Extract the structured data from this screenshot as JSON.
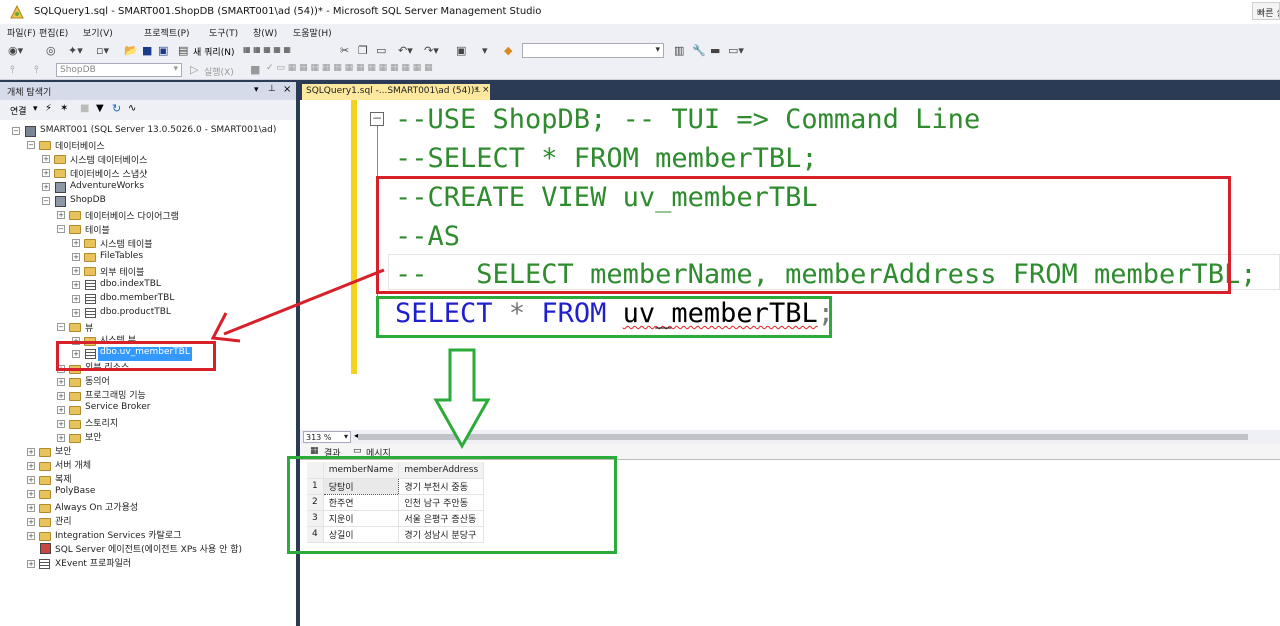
{
  "window": {
    "title": "SQLQuery1.sql - SMART001.ShopDB (SMART001\\ad (54))* - Microsoft SQL Server Management Studio",
    "quick_launch": "빠른 실행"
  },
  "menu": [
    "파일(F)",
    "편집(E)",
    "보기(V)",
    "프로젝트(P)",
    "도구(T)",
    "창(W)",
    "도움말(H)"
  ],
  "toolbar": {
    "new_query": "새 쿼리(N)",
    "database": "ShopDB",
    "execute": "실행(X)"
  },
  "explorer": {
    "title": "개체 탐색기",
    "connect": "연결",
    "server": "SMART001 (SQL Server 13.0.5026.0 - SMART001\\ad)",
    "nodes": {
      "databases": "데이터베이스",
      "system_databases": "시스템 데이터베이스",
      "snapshots": "데이터베이스 스냅샷",
      "adventureworks": "AdventureWorks",
      "shopdb": "ShopDB",
      "diagrams": "데이터베이스 다이어그램",
      "tables": "테이블",
      "system_tables": "시스템 테이블",
      "filetables": "FileTables",
      "external_tables": "외부 테이블",
      "index_tbl": "dbo.indexTBL",
      "member_tbl": "dbo.memberTBL",
      "product_tbl": "dbo.productTBL",
      "views": "뷰",
      "system_views": "시스템 뷰",
      "uv_member": "dbo.uv_memberTBL",
      "external_resources": "외부 리소스",
      "synonyms": "동의어",
      "programmability": "프로그래밍 기능",
      "service_broker": "Service Broker",
      "storage": "스토리지",
      "db_security": "보안",
      "security": "보안",
      "server_objects": "서버 개체",
      "replication": "복제",
      "polybase": "PolyBase",
      "always_on": "Always On 고가용성",
      "management": "관리",
      "integration_services": "Integration Services 카탈로그",
      "sql_agent": "SQL Server 에이전트(에이전트 XPs 사용 안 함)",
      "xevent": "XEvent 프로파일러"
    }
  },
  "editor": {
    "tab_title": "SQLQuery1.sql -...SMART001\\ad (54))*",
    "zoom": "313 %",
    "lines": {
      "l1": "--USE ShopDB; -- TUI => Command Line",
      "l2": "--SELECT * FROM memberTBL;",
      "l3": "--CREATE VIEW uv_memberTBL",
      "l4": "--AS",
      "l5": "--   SELECT memberName, memberAddress FROM memberTBL;",
      "l6_select": "SELECT",
      "l6_star": "*",
      "l6_from": "FROM",
      "l6_obj": "uv_memberTBL",
      "l6_semi": ";"
    }
  },
  "results": {
    "tab_results": "결과",
    "tab_messages": "메시지",
    "columns": [
      "memberName",
      "memberAddress"
    ],
    "rows": [
      {
        "n": "1",
        "name": "당탕이",
        "addr": "경기 부천시 중동"
      },
      {
        "n": "2",
        "name": "한주연",
        "addr": "인천 남구 주안동"
      },
      {
        "n": "3",
        "name": "지운이",
        "addr": "서울 은평구 증산동"
      },
      {
        "n": "4",
        "name": "상길이",
        "addr": "경기 성남시 분당구"
      }
    ]
  },
  "colors": {
    "annotation_red": "#d8202a",
    "annotation_green": "#2bab3a",
    "comment_green": "#2e8b2e",
    "keyword_blue": "#1f1fcc"
  }
}
